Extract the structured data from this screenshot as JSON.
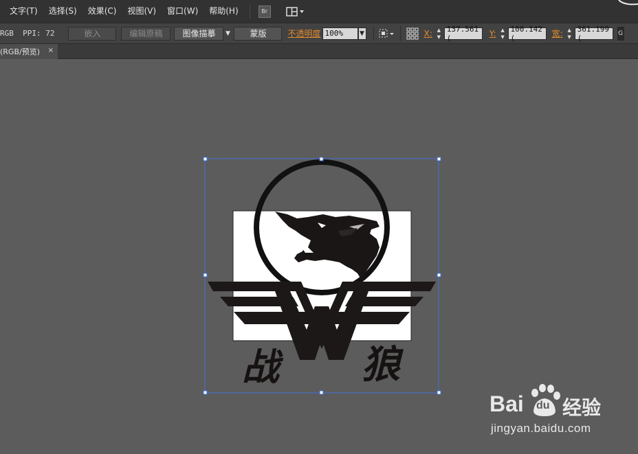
{
  "menubar": {
    "items": [
      "文字(T)",
      "选择(S)",
      "效果(C)",
      "视图(V)",
      "窗口(W)",
      "帮助(H)"
    ],
    "bridge_label": "Br"
  },
  "toolbar": {
    "info": "RGB  PPI: 72",
    "embed_label": "嵌入",
    "edit_original_label": "编辑原稿",
    "image_trace_label": "图像描摹",
    "mask_label": "蒙版",
    "opacity_label": "不透明度",
    "opacity_value": "100%",
    "x_label": "X:",
    "x_value": "137.561 (",
    "y_label": "Y:",
    "y_value": "100.142 (",
    "w_label": "宽:",
    "w_value": "361.199 ("
  },
  "tab": {
    "title": "(RGB/预览)",
    "close": "×"
  },
  "artwork": {
    "left_char": "战",
    "right_char": "狼"
  },
  "watermark": {
    "brand": "Bai",
    "brand_paw": "du",
    "product": "经验",
    "url": "jingyan.baidu.com"
  },
  "colors": {
    "accent_orange": "#e58a2c",
    "selection_blue": "#3f6fd6",
    "canvas_gray": "#5c5c5c"
  }
}
